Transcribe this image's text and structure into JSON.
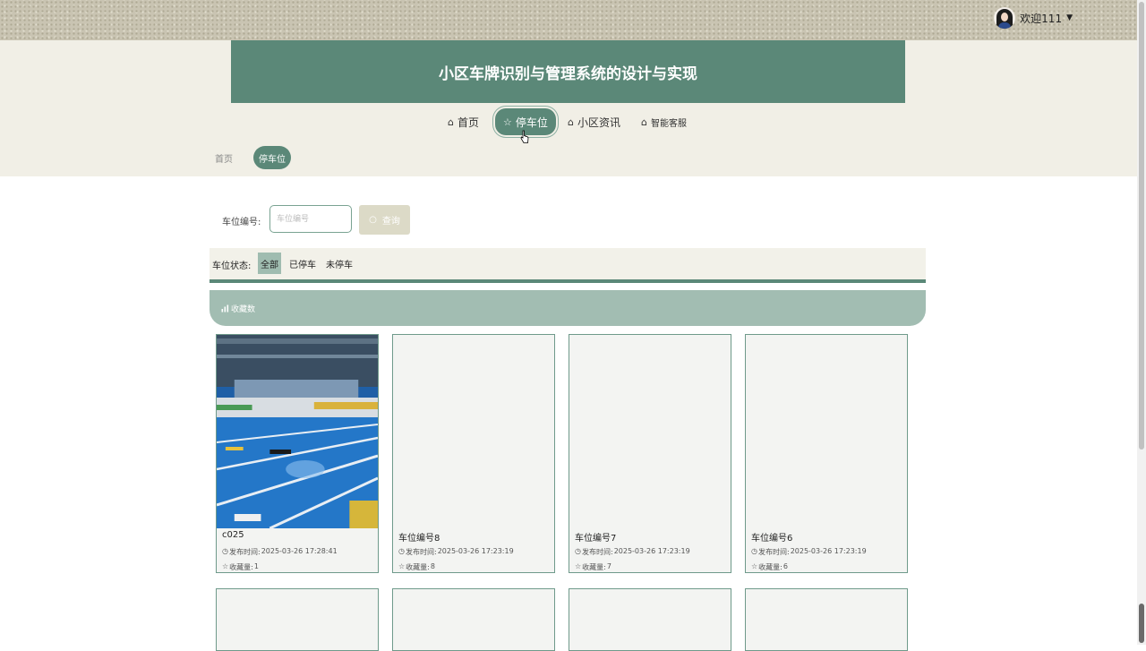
{
  "header": {
    "title": "小区车牌识别与管理系统的设计与实现",
    "user_greeting": "欢迎111",
    "avatar_icon": "user-avatar",
    "dropdown_caret": "▼"
  },
  "nav": {
    "items": [
      {
        "icon": "⌂",
        "label": "首页"
      },
      {
        "icon": "☆",
        "label": "停车位",
        "active": true
      },
      {
        "icon": "⌂",
        "label": "小区资讯"
      },
      {
        "icon": "⌂",
        "label": "智能客服"
      }
    ]
  },
  "breadcrumb": {
    "home": "首页",
    "current": "停车位"
  },
  "search": {
    "label": "车位编号:",
    "placeholder": "车位编号",
    "button_icon": "○",
    "button_label": "查询"
  },
  "filter": {
    "label": "车位状态:",
    "options": [
      {
        "label": "全部",
        "active": true
      },
      {
        "label": "已停车"
      },
      {
        "label": "未停车"
      }
    ]
  },
  "sort": {
    "label": "收藏数",
    "icon": "bar-chart-icon"
  },
  "cards": [
    {
      "name": "c025",
      "time_label": "发布时间:",
      "time": "2025-03-26 17:28:41",
      "fav_label": "收藏量:",
      "fav": "1",
      "has_image": true
    },
    {
      "name": "车位编号8",
      "time_label": "发布时间:",
      "time": "2025-03-26 17:23:19",
      "fav_label": "收藏量:",
      "fav": "8",
      "has_image": false
    },
    {
      "name": "车位编号7",
      "time_label": "发布时间:",
      "time": "2025-03-26 17:23:19",
      "fav_label": "收藏量:",
      "fav": "7",
      "has_image": false
    },
    {
      "name": "车位编号6",
      "time_label": "发布时间:",
      "time": "2025-03-26 17:23:19",
      "fav_label": "收藏量:",
      "fav": "6",
      "has_image": false
    }
  ],
  "colors": {
    "brand": "#5b8878",
    "brand_light": "#a2bdb2",
    "header_bg": "#f1efe6",
    "button_muted": "#dcdac7"
  }
}
